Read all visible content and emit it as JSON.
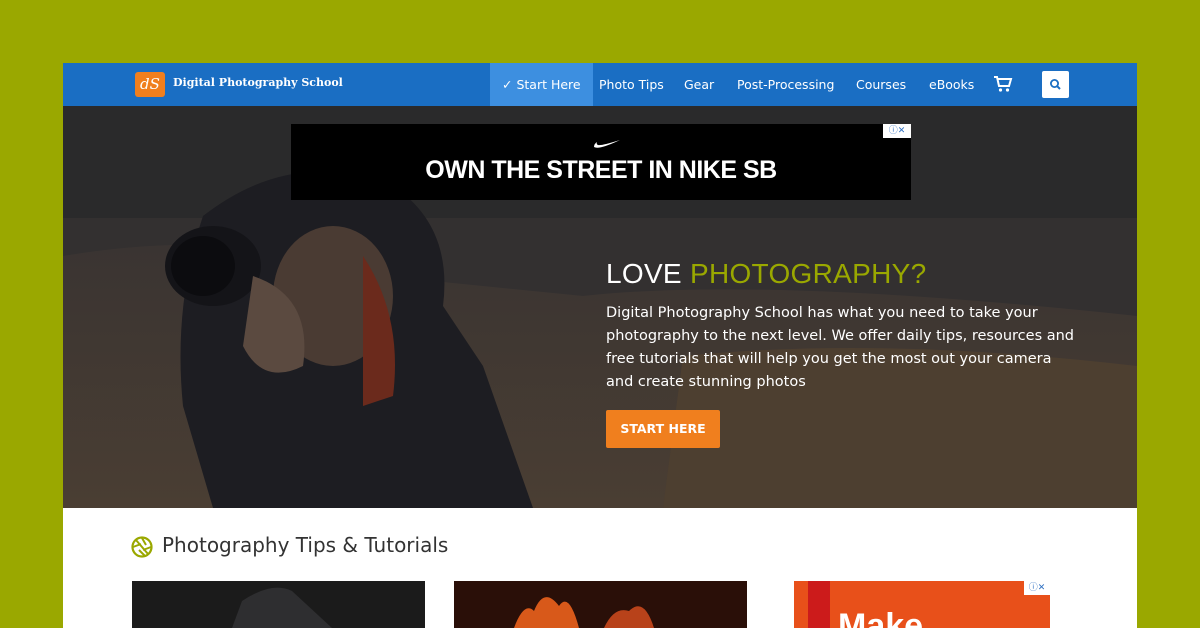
{
  "header": {
    "logo_text": "dS",
    "brand": "Digital Photography School",
    "nav": [
      {
        "label": "✓ Start Here",
        "active": true
      },
      {
        "label": "Photo Tips"
      },
      {
        "label": "Gear"
      },
      {
        "label": "Post-Processing"
      },
      {
        "label": "Courses"
      },
      {
        "label": "eBooks"
      }
    ],
    "cart_icon": "cart-icon",
    "search_icon": "search-icon"
  },
  "hero": {
    "ad": {
      "headline": "OWN THE STREET IN NIKE SB",
      "controls": "ⓘ✕",
      "logo_icon": "swoosh-icon"
    },
    "title_plain": "LOVE ",
    "title_accent": "PHOTOGRAPHY?",
    "body": "Digital Photography School has what you need to take your photography to the next level. We offer daily tips, resources and free tutorials that will help you get the most out your camera and create stunning photos",
    "cta_label": "START HERE"
  },
  "section": {
    "title": "Photography Tips & Tutorials",
    "icon": "aperture-icon"
  },
  "side_ad": {
    "controls": "ⓘ✕",
    "text": "Make"
  },
  "colors": {
    "page_bg": "#9aa800",
    "nav_bg": "#1a6ec3",
    "nav_active": "#3d8fe0",
    "accent_green": "#9aa800",
    "cta_orange": "#f07f1e"
  }
}
